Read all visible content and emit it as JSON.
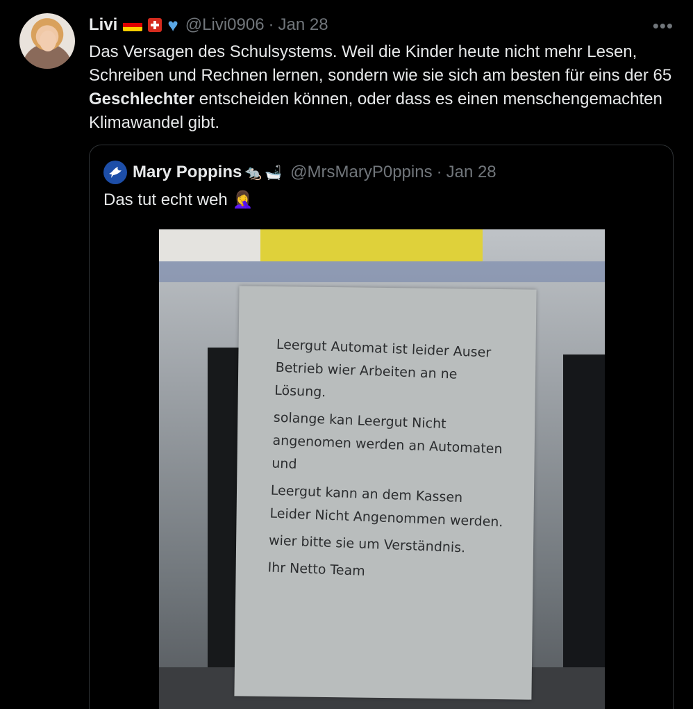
{
  "tweet": {
    "display_name": "Livi",
    "handle": "@Livi0906",
    "separator": "·",
    "date": "Jan 28",
    "more_icon": "more-horizontal-icon",
    "text_part1": "Das Versagen des Schulsystems. Weil die Kinder heute nicht mehr Lesen, Schreiben und Rechnen lernen, sondern wie sie sich am besten für eins der 65 ",
    "text_bold": "Geschlechter",
    "text_part2": " entscheiden können, oder dass es einen menschengemachten Klimawandel gibt."
  },
  "quote": {
    "display_name": "Mary Poppins",
    "handle": "@MrsMaryP0ppins",
    "separator": "·",
    "date": "Jan 28",
    "text": "Das tut echt weh",
    "emoji_facepalm": "🤦‍♀️",
    "emoji_rat": "🐀",
    "emoji_bathtub": "🛁",
    "note_lines": [
      "Leergut Automat ist leider Auser Betrieb wier Arbeiten an ne Lösung.",
      "solange kan Leergut Nicht angenomen werden an Automaten und",
      "Leergut kann an dem Kassen Leider Nicht Angenommen werden.",
      "wier bitte sie um Verständnis.",
      "Ihr Netto Team"
    ]
  },
  "colors": {
    "background": "#000000",
    "text": "#e7e9ea",
    "muted": "#71767b",
    "border": "#2f3336"
  }
}
